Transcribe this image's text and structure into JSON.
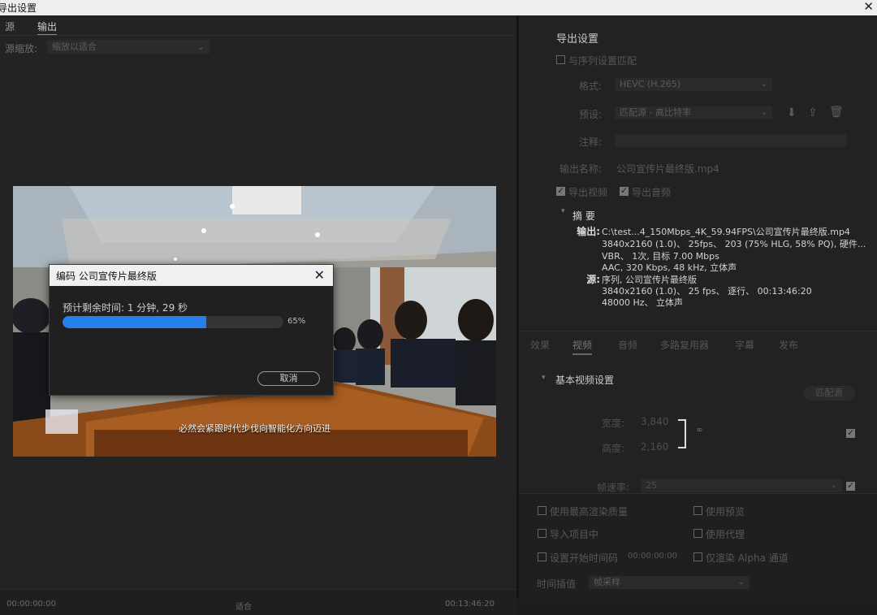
{
  "window": {
    "title": "导出设置"
  },
  "left": {
    "tabs": [
      "源",
      "输出"
    ],
    "source_scaling_label": "源缩放:",
    "source_scaling_value": "缩放以适合"
  },
  "preview": {
    "subtitle": "必然会紧跟时代步伐向智能化方向迈进"
  },
  "bottom": {
    "start": "00:00:00:00",
    "end": "00:13:46:20",
    "fit": "适合"
  },
  "export_settings": {
    "header": "导出设置",
    "match_sequence": "与序列设置匹配",
    "format_label": "格式:",
    "format_value": "HEVC (H.265)",
    "preset_label": "预设:",
    "preset_value": "匹配源 - 高比特率",
    "comment_label": "注释:",
    "output_name_label": "输出名称:",
    "output_name_value": "公司宣传片最终版.mp4",
    "export_video": "导出视频",
    "export_audio": "导出音频"
  },
  "summary": {
    "header": "摘 要",
    "output_label": "输出:",
    "output_lines": [
      "C:\\test...4_150Mbps_4K_59.94FPS\\公司宣传片最终版.mp4",
      "3840x2160 (1.0)、 25fps、 203 (75% HLG, 58% PQ), 硬件...",
      "VBR、 1次, 目标 7.00 Mbps",
      "AAC, 320 Kbps, 48  kHz, 立体声"
    ],
    "source_label": "源:",
    "source_lines": [
      "序列, 公司宣传片最终版",
      "3840x2160 (1.0)、 25 fps、 逐行、 00:13:46:20",
      "48000 Hz、 立体声"
    ]
  },
  "settings_tabs": [
    "效果",
    "视频",
    "音频",
    "多路复用器",
    "字幕",
    "发布"
  ],
  "basic_video": {
    "header": "基本视频设置",
    "match_source_btn": "匹配源",
    "width_label": "宽度:",
    "width_value": "3,840",
    "height_label": "高度:",
    "height_value": "2,160",
    "framerate_label": "帧速率:",
    "framerate_value": "25"
  },
  "options": {
    "max_render_quality": "使用最高渲染质量",
    "use_previews": "使用预览",
    "import_into_project": "导入项目中",
    "use_proxies": "使用代理",
    "set_start_timecode": "设置开始时间码",
    "start_timecode": "00:00:00:00",
    "render_alpha_only": "仅渲染 Alpha 通道",
    "time_interpolation_label": "时间插值",
    "time_interpolation_value": "帧采样"
  },
  "dialog": {
    "title": "编码 公司宣传片最终版",
    "remaining": "预计剩余时间: 1 分钟, 29 秒",
    "progress": 0.65,
    "percent_label": "65%",
    "cancel": "取消"
  }
}
